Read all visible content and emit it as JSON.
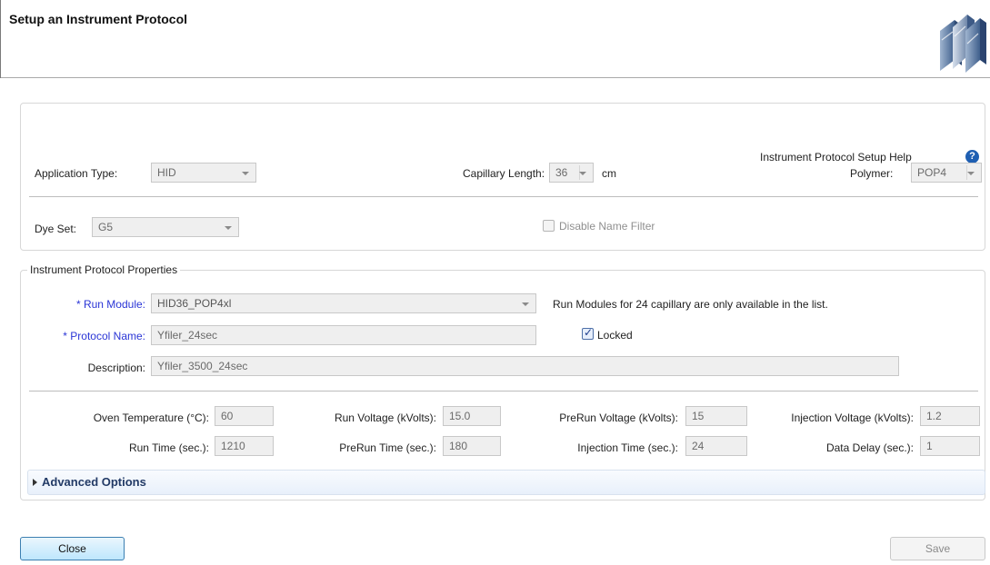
{
  "window": {
    "title": "Setup an Instrument Protocol",
    "logo_icon": "instrument-logo-icon"
  },
  "help": {
    "label": "Instrument Protocol Setup Help",
    "icon": "question-icon"
  },
  "application_type": {
    "label": "Application Type:",
    "value": "HID"
  },
  "capillary_length": {
    "label": "Capillary Length:",
    "value": "36",
    "unit": "cm"
  },
  "polymer": {
    "label": "Polymer:",
    "value": "POP4"
  },
  "dye_set": {
    "label": "Dye Set:",
    "value": "G5"
  },
  "disable_name_filter": {
    "label": "Disable Name Filter",
    "checked": false
  },
  "properties": {
    "legend": "Instrument Protocol Properties",
    "required_marker": "*",
    "run_module": {
      "label": "Run Module:",
      "value": "HID36_POP4xl",
      "note": "Run Modules for 24 capillary are only available in the list."
    },
    "protocol_name": {
      "label": "Protocol Name:",
      "value": "Yfiler_24sec"
    },
    "locked": {
      "label": "Locked",
      "checked": true
    },
    "description": {
      "label": "Description:",
      "value": "Yfiler_3500_24sec"
    }
  },
  "params": {
    "oven_temperature": {
      "label": "Oven Temperature (°C):",
      "value": "60"
    },
    "run_voltage": {
      "label": "Run Voltage (kVolts):",
      "value": "15.0"
    },
    "prerun_voltage": {
      "label": "PreRun Voltage (kVolts):",
      "value": "15"
    },
    "injection_voltage": {
      "label": "Injection Voltage (kVolts):",
      "value": "1.2"
    },
    "run_time": {
      "label": "Run Time (sec.):",
      "value": "1210"
    },
    "prerun_time": {
      "label": "PreRun Time (sec.):",
      "value": "180"
    },
    "injection_time": {
      "label": "Injection Time (sec.):",
      "value": "24"
    },
    "data_delay": {
      "label": "Data Delay (sec.):",
      "value": "1"
    }
  },
  "advanced": {
    "label": "Advanced Options",
    "expanded": false
  },
  "buttons": {
    "close": "Close",
    "save": "Save"
  }
}
